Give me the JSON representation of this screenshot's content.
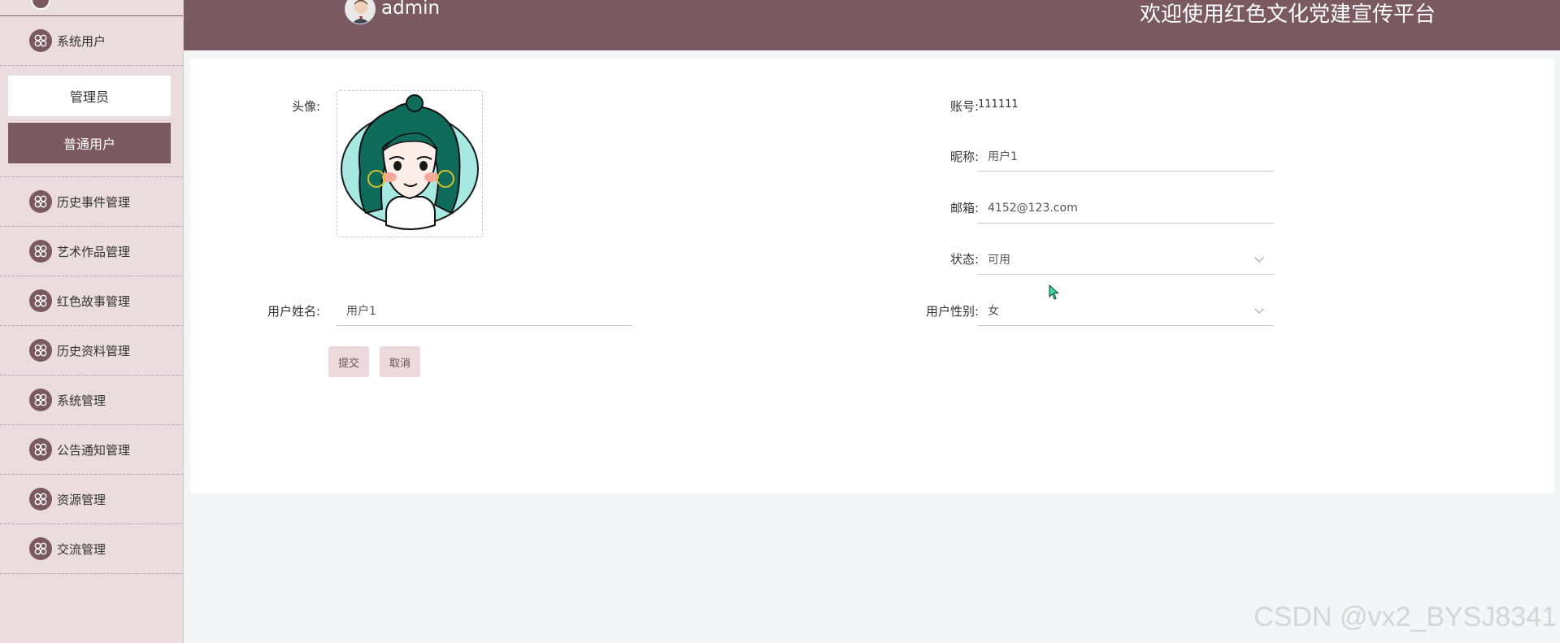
{
  "header": {
    "username": "admin",
    "welcome": "欢迎使用红色文化党建宣传平台"
  },
  "sidebar": {
    "system_users": "系统用户",
    "sub_items": [
      "管理员",
      "普通用户"
    ],
    "items": [
      "历史事件管理",
      "艺术作品管理",
      "红色故事管理",
      "历史资料管理",
      "系统管理",
      "公告通知管理",
      "资源管理",
      "交流管理"
    ]
  },
  "form": {
    "avatar_label": "头像:",
    "account_label": "账号:",
    "account_value": "111111",
    "nickname_label": "昵称:",
    "nickname_value": "用户1",
    "email_label": "邮箱:",
    "email_value": "4152@123.com",
    "status_label": "状态:",
    "status_value": "可用",
    "realname_label": "用户姓名:",
    "realname_value": "用户1",
    "gender_label": "用户性别:",
    "gender_value": "女",
    "submit": "提交",
    "cancel": "取消"
  },
  "watermark": "CSDN @vx2_BYSJ8341",
  "colors": {
    "primary": "#7a5960",
    "sidebar_bg": "#ebdcdd",
    "button_bg": "#ebd9dc"
  }
}
